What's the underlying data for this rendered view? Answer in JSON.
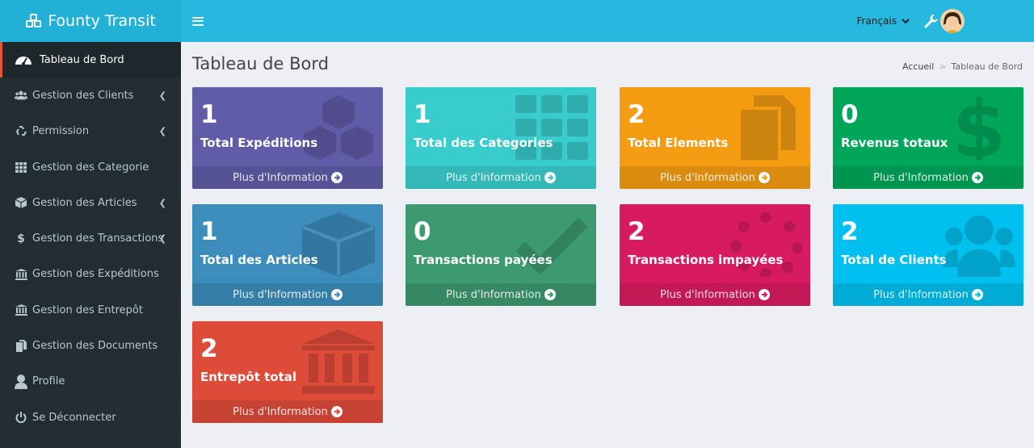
{
  "brand": {
    "name": "Founty Transit",
    "icon": "cubes-icon"
  },
  "header": {
    "language": "Français",
    "settings_icon": "wrench-icon"
  },
  "sidebar": {
    "items": [
      {
        "label": "Tableau de Bord",
        "icon": "dashboard-icon",
        "active": true,
        "has_submenu": false
      },
      {
        "label": "Gestion des Clients",
        "icon": "users-icon",
        "has_submenu": true
      },
      {
        "label": "Permission",
        "icon": "recycle-icon",
        "has_submenu": true
      },
      {
        "label": "Gestion des Categorie",
        "icon": "grid-icon",
        "has_submenu": false
      },
      {
        "label": "Gestion des Articles",
        "icon": "cube-icon",
        "has_submenu": true
      },
      {
        "label": "Gestion des Transactions",
        "icon": "dollar-icon",
        "has_submenu": true
      },
      {
        "label": "Gestion des Expéditions",
        "icon": "bank-icon",
        "has_submenu": false
      },
      {
        "label": "Gestion des Entrepôt",
        "icon": "bank-icon",
        "has_submenu": false
      },
      {
        "label": "Gestion des Documents",
        "icon": "copy-icon",
        "has_submenu": false
      },
      {
        "label": "Profile",
        "icon": "user-icon",
        "has_submenu": false
      },
      {
        "label": "Se Déconnecter",
        "icon": "power-icon",
        "has_submenu": false
      }
    ]
  },
  "page": {
    "title": "Tableau de Bord",
    "breadcrumb": {
      "home": "Accueil",
      "separator": ">",
      "current": "Tableau de Bord"
    }
  },
  "more_info_label": "Plus d'Information",
  "boxes": [
    {
      "value": "1",
      "label": "Total Expéditions",
      "color": "#605ca8",
      "icon": "cubes-icon"
    },
    {
      "value": "1",
      "label": "Total des Categories",
      "color": "#39cccc",
      "icon": "grid-icon"
    },
    {
      "value": "2",
      "label": "Total Elements",
      "color": "#f39c12",
      "icon": "copy-icon"
    },
    {
      "value": "0",
      "label": "Revenus totaux",
      "color": "#00a65a",
      "icon": "dollar-icon"
    },
    {
      "value": "1",
      "label": "Total des Articles",
      "color": "#3c8dbc",
      "icon": "cube-icon"
    },
    {
      "value": "0",
      "label": "Transactions payées",
      "color": "#3d9970",
      "icon": "check-icon"
    },
    {
      "value": "2",
      "label": "Transactions impayées",
      "color": "#d81b60",
      "icon": "spinner-icon"
    },
    {
      "value": "2",
      "label": "Total de Clients",
      "color": "#00c0ef",
      "icon": "users-icon"
    },
    {
      "value": "2",
      "label": "Entrepôt total",
      "color": "#dd4b39",
      "icon": "bank-icon"
    }
  ]
}
